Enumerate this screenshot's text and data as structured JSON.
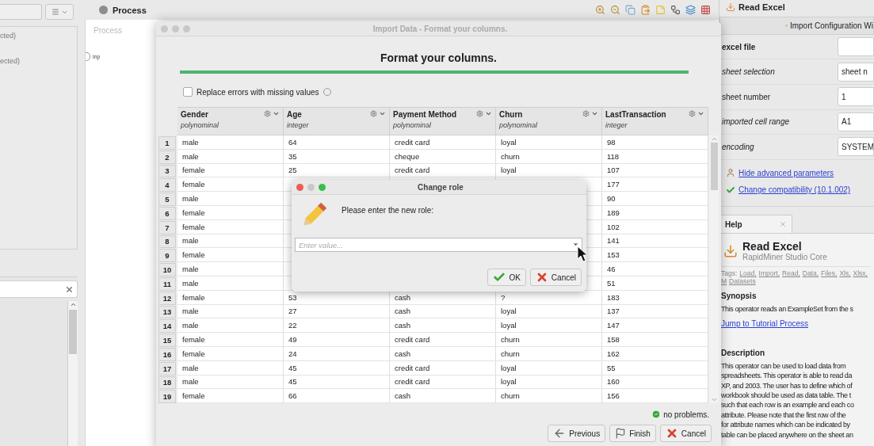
{
  "left_panel": {
    "items": [
      "cted)",
      "ected)"
    ]
  },
  "process_panel": {
    "title": "Process",
    "canvas_label": "Process",
    "port": "inp"
  },
  "operator_panel": {
    "title": "Read Excel",
    "wizard_button": "Import Configuration Wi",
    "parameters": [
      {
        "label": "excel file",
        "kind": "bold"
      },
      {
        "label": "sheet selection",
        "kind": "italic",
        "value": "sheet n"
      },
      {
        "label": "sheet number",
        "kind": "plain",
        "value": "1"
      },
      {
        "label": "imported cell range",
        "kind": "italic",
        "value": "A1"
      },
      {
        "label": "encoding",
        "kind": "italic",
        "value": "SYSTEM"
      }
    ],
    "links": [
      {
        "label": "Hide advanced parameters",
        "kind": "expert"
      },
      {
        "label": "Change compatibility (10.1.002)",
        "kind": "check"
      }
    ]
  },
  "help": {
    "tab": "Help",
    "title": "Read Excel",
    "subtitle": "RapidMiner Studio Core",
    "tags_label": "Tags:",
    "tags": [
      "Load,",
      "Import,",
      "Read,",
      "Data,",
      "Files,",
      "Xls,",
      "Xlsx,",
      "M",
      "Datasets"
    ],
    "synopsis_heading": "Synopsis",
    "synopsis": "This operator reads an ExampleSet from the s",
    "tutorial_link": "Jump to Tutorial Process",
    "description_heading": "Description",
    "description_lines": [
      "This operator can be used to load data from",
      "spreadsheets. This operator is able to read da",
      "XP, and 2003. The user has to define which of",
      "workbook should be used as data table. The t",
      "such that each row is an example and each co",
      "attribute. Please note that the first row of the",
      "for attribute names which can be indicated by",
      "table can be placed anywhere on the sheet an"
    ]
  },
  "import_window": {
    "title": "Import Data - Format your columns.",
    "heading": "Format your columns.",
    "checkbox": {
      "label": "Replace errors with missing values",
      "checked": false
    },
    "table": {
      "columns": [
        {
          "name": "Gender",
          "type": "polynominal"
        },
        {
          "name": "Age",
          "type": "integer"
        },
        {
          "name": "Payment Method",
          "type": "polynominal"
        },
        {
          "name": "Churn",
          "type": "polynominal"
        },
        {
          "name": "LastTransaction",
          "type": "integer"
        }
      ],
      "rows": [
        {
          "n": "1",
          "cells": [
            "male",
            "64",
            "credit card",
            "loyal",
            "98"
          ]
        },
        {
          "n": "2",
          "cells": [
            "male",
            "35",
            "cheque",
            "churn",
            "118"
          ]
        },
        {
          "n": "3",
          "cells": [
            "female",
            "25",
            "credit card",
            "loyal",
            "107"
          ]
        },
        {
          "n": "4",
          "cells": [
            "female",
            null,
            null,
            null,
            "177"
          ]
        },
        {
          "n": "5",
          "cells": [
            "male",
            null,
            null,
            null,
            "90"
          ]
        },
        {
          "n": "6",
          "cells": [
            "female",
            null,
            null,
            null,
            "189"
          ]
        },
        {
          "n": "7",
          "cells": [
            "female",
            null,
            null,
            null,
            "102"
          ]
        },
        {
          "n": "8",
          "cells": [
            "male",
            null,
            null,
            null,
            "141"
          ]
        },
        {
          "n": "9",
          "cells": [
            "female",
            null,
            null,
            null,
            "153"
          ]
        },
        {
          "n": "10",
          "cells": [
            "male",
            null,
            null,
            null,
            "46"
          ]
        },
        {
          "n": "11",
          "cells": [
            "male",
            null,
            null,
            null,
            "51"
          ]
        },
        {
          "n": "12",
          "cells": [
            "female",
            "53",
            "cash",
            "?",
            "183"
          ]
        },
        {
          "n": "13",
          "cells": [
            "male",
            "27",
            "cash",
            "loyal",
            "137"
          ]
        },
        {
          "n": "14",
          "cells": [
            "male",
            "22",
            "cash",
            "loyal",
            "147"
          ]
        },
        {
          "n": "15",
          "cells": [
            "female",
            "49",
            "credit card",
            "churn",
            "158"
          ]
        },
        {
          "n": "16",
          "cells": [
            "female",
            "24",
            "cash",
            "churn",
            "162"
          ]
        },
        {
          "n": "17",
          "cells": [
            "male",
            "45",
            "credit card",
            "loyal",
            "55"
          ]
        },
        {
          "n": "18",
          "cells": [
            "male",
            "45",
            "credit card",
            "loyal",
            "160"
          ]
        },
        {
          "n": "19",
          "cells": [
            "female",
            "66",
            "cash",
            "churn",
            "156"
          ]
        }
      ]
    },
    "status": "no problems.",
    "buttons": [
      {
        "label": "Previous",
        "kind": "previous"
      },
      {
        "label": "Finish",
        "kind": "finish"
      },
      {
        "label": "Cancel",
        "kind": "cancel"
      }
    ]
  },
  "dialog": {
    "title": "Change role",
    "prompt": "Please enter the new role:",
    "placeholder": "Enter value...",
    "buttons": [
      {
        "label": "OK",
        "kind": "ok"
      },
      {
        "label": "Cancel",
        "kind": "cancel"
      }
    ]
  }
}
